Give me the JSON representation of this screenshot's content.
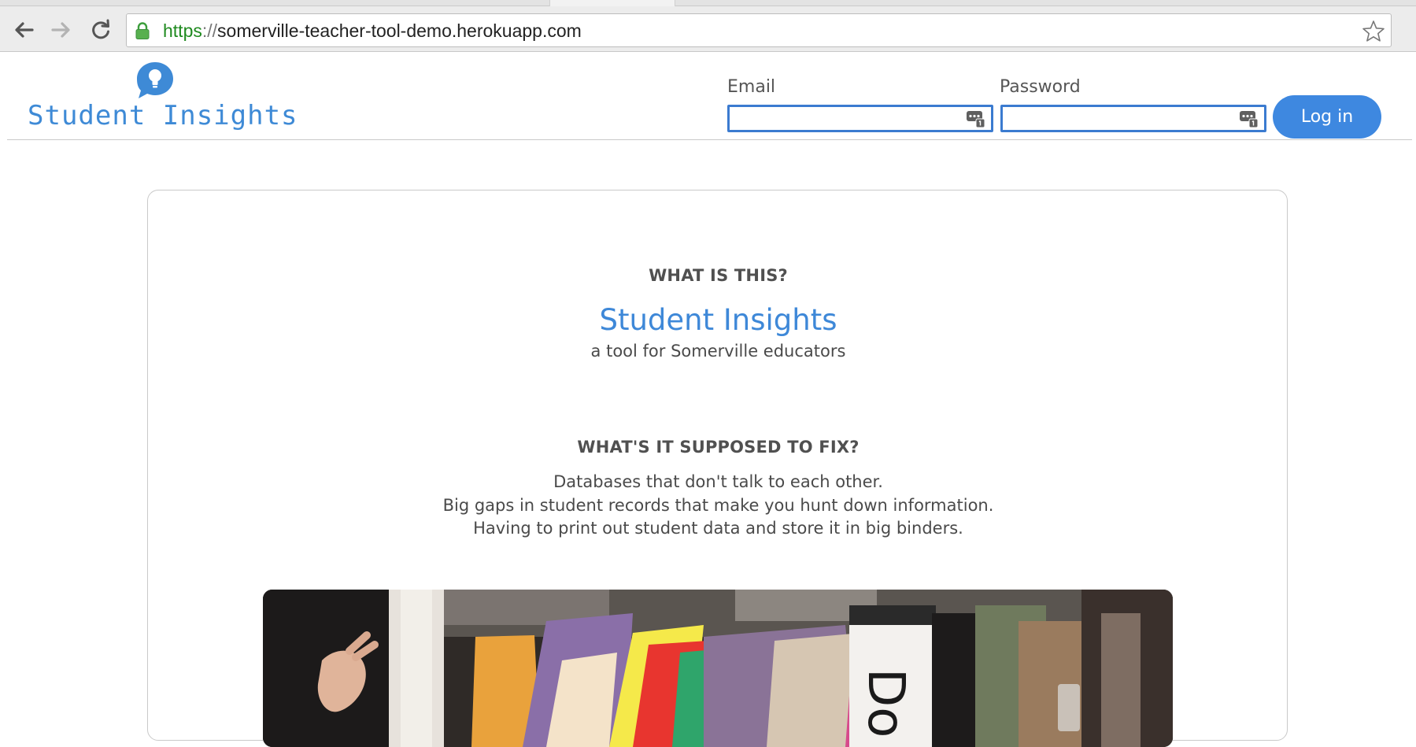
{
  "browser": {
    "url_scheme": "https",
    "url_separator": "://",
    "url_host": "somerville-teacher-tool-demo.herokuapp.com"
  },
  "header": {
    "logo_text": "Student Insights",
    "email_label": "Email",
    "email_value": "",
    "password_label": "Password",
    "password_value": "",
    "login_label": "Log in"
  },
  "main": {
    "what_heading": "WHAT IS THIS?",
    "product_name": "Student Insights",
    "tagline": "a tool for Somerville educators",
    "fix_heading": "WHAT'S IT SUPPOSED TO FIX?",
    "problems": [
      "Databases that don't talk to each other.",
      "Big gaps in student records that make you hunt down information.",
      "Having to print out student data and store it in big binders."
    ]
  },
  "colors": {
    "accent": "#3e88e0",
    "logo": "#3e8ad6",
    "secure_url": "#1f8a1f"
  },
  "icons": [
    "back-icon",
    "forward-icon",
    "reload-icon",
    "lock-icon",
    "star-icon",
    "lightbulb-bubble-icon",
    "autofill-key-icon"
  ]
}
